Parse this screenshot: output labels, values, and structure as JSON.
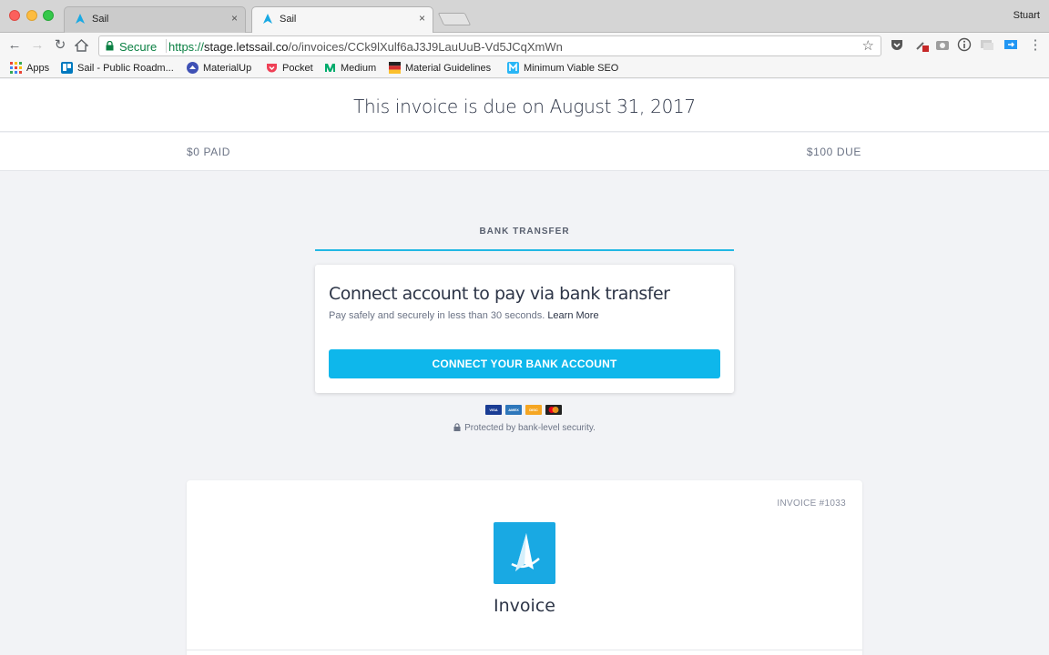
{
  "browser": {
    "tabs": [
      {
        "title": "Sail",
        "active": false
      },
      {
        "title": "Sail",
        "active": true
      }
    ],
    "tab_close_glyph": "×",
    "profile_name": "Stuart",
    "omnibox": {
      "secure_label": "Secure",
      "url_protocol": "https://",
      "url_host": "stage.letssail.co",
      "url_path": "/o/invoices/CCk9lXulf6aJ3J9LauUuB-Vd5JCqXmWn"
    },
    "bookmarks": [
      {
        "label": "Apps",
        "icon": "apps-grid-icon"
      },
      {
        "label": "Sail - Public Roadm...",
        "icon": "trello-icon"
      },
      {
        "label": "MaterialUp",
        "icon": "materialup-icon"
      },
      {
        "label": "Pocket",
        "icon": "pocket-icon"
      },
      {
        "label": "Medium",
        "icon": "medium-icon"
      },
      {
        "label": "Material Guidelines",
        "icon": "material-guidelines-icon"
      },
      {
        "label": "Minimum Viable SEO",
        "icon": "mvseo-icon"
      }
    ]
  },
  "page": {
    "due_title": "This invoice is due on August 31, 2017",
    "paid_label": "$0 PAID",
    "due_label": "$100 DUE",
    "method_tab": "BANK TRANSFER",
    "connect_card": {
      "title": "Connect account to pay via bank transfer",
      "subtitle": "Pay safely and securely in less than 30 seconds.",
      "learn_more": "Learn More",
      "button": "CONNECT YOUR BANK ACCOUNT"
    },
    "payment_cards": [
      {
        "name": "visa-icon",
        "label": "VISA",
        "color": "#1a3c94"
      },
      {
        "name": "amex-icon",
        "label": "AMEX",
        "color": "#2e77bb"
      },
      {
        "name": "discover-icon",
        "label": "DISC",
        "color": "#f5a623"
      },
      {
        "name": "mastercard-icon",
        "label": "",
        "color": "#222222"
      }
    ],
    "security_note": "Protected by bank-level security.",
    "invoice": {
      "number": "INVOICE #1033",
      "title": "Invoice"
    }
  },
  "colors": {
    "accent": "#0eb7eb",
    "tab_underline": "#22b8e4",
    "logo_bg": "#19a9e3"
  }
}
